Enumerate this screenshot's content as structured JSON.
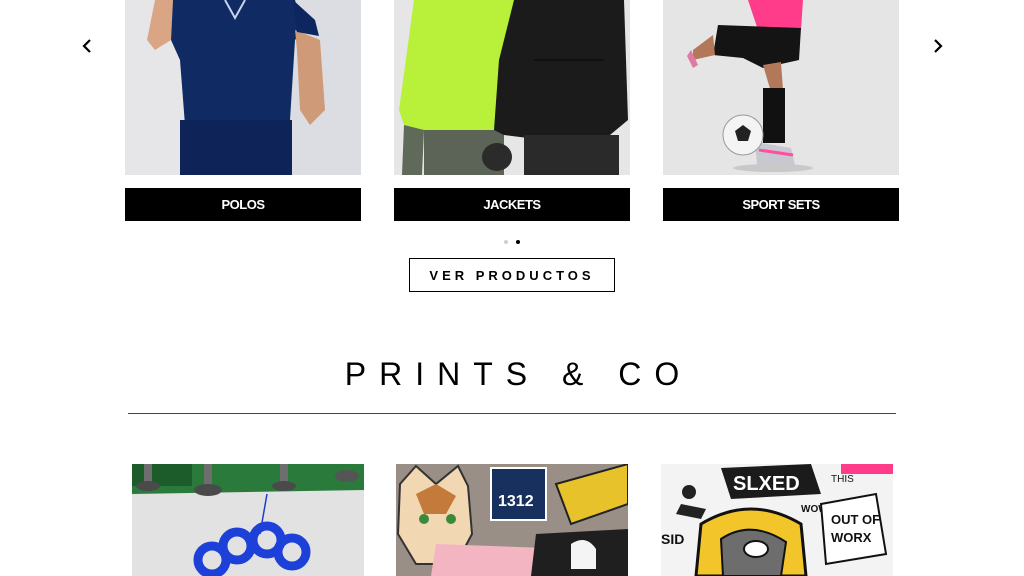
{
  "carousel": {
    "prev_icon": "chevron-left-icon",
    "next_icon": "chevron-right-icon",
    "items": [
      {
        "label": "POLOS"
      },
      {
        "label": "JACKETS"
      },
      {
        "label": "SPORT SETS"
      }
    ],
    "pagination": {
      "total": 2,
      "active": 2
    },
    "cta_label": "VER PRODUCTOS"
  },
  "prints": {
    "title": "PRINTS & CO"
  },
  "colors": {
    "label_bg": "#000000",
    "label_text": "#ffffff",
    "card_bg": "#e8e8e8"
  }
}
